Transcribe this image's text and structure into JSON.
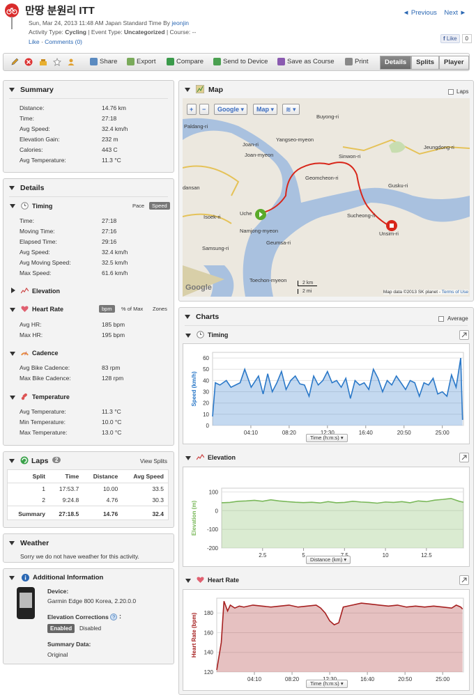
{
  "header": {
    "title": "만땅 분원리 ITT",
    "date_line": "Sun, Mar 24, 2013 11:48 AM Japan Standard Time By ",
    "author": "jeonjin",
    "activity_type_label": "Activity Type: ",
    "activity_type": "Cycling",
    "event_type_label": " | Event Type: ",
    "event_type": "Uncategorized",
    "course_label": " | Course: --",
    "like_link": "Like",
    "comments_link": "Comments (0)",
    "previous": "◄ Previous",
    "next": "Next ►",
    "fb_like": "Like",
    "fb_count": "0"
  },
  "toolbar": {
    "share": "Share",
    "export": "Export",
    "compare": "Compare",
    "send": "Send to Device",
    "save_course": "Save as Course",
    "print": "Print",
    "tabs": [
      "Details",
      "Splits",
      "Player"
    ]
  },
  "summary": {
    "title": "Summary",
    "rows": [
      {
        "label": "Distance:",
        "value": "14.76 km"
      },
      {
        "label": "Time:",
        "value": "27:18"
      },
      {
        "label": "Avg Speed:",
        "value": "32.4 km/h"
      },
      {
        "label": "Elevation Gain:",
        "value": "232 m"
      },
      {
        "label": "Calories:",
        "value": "443 C"
      },
      {
        "label": "Avg Temperature:",
        "value": "11.3 °C"
      }
    ]
  },
  "details": {
    "title": "Details",
    "timing": {
      "title": "Timing",
      "pace": "Pace",
      "speed": "Speed",
      "rows": [
        {
          "label": "Time:",
          "value": "27:18"
        },
        {
          "label": "Moving Time:",
          "value": "27:16"
        },
        {
          "label": "Elapsed Time:",
          "value": "29:16"
        },
        {
          "label": "Avg Speed:",
          "value": "32.4 km/h"
        },
        {
          "label": "Avg Moving Speed:",
          "value": "32.5 km/h"
        },
        {
          "label": "Max Speed:",
          "value": "61.6 km/h"
        }
      ]
    },
    "elevation": {
      "title": "Elevation"
    },
    "heart_rate": {
      "title": "Heart Rate",
      "bpm": "bpm",
      "pct_max": "% of Max",
      "zones": "Zones",
      "rows": [
        {
          "label": "Avg HR:",
          "value": "185 bpm"
        },
        {
          "label": "Max HR:",
          "value": "195 bpm"
        }
      ]
    },
    "cadence": {
      "title": "Cadence",
      "rows": [
        {
          "label": "Avg Bike Cadence:",
          "value": "83 rpm"
        },
        {
          "label": "Max Bike Cadence:",
          "value": "128 rpm"
        }
      ]
    },
    "temperature": {
      "title": "Temperature",
      "rows": [
        {
          "label": "Avg Temperature:",
          "value": "11.3 °C"
        },
        {
          "label": "Min Temperature:",
          "value": "10.0 °C"
        },
        {
          "label": "Max Temperature:",
          "value": "13.0 °C"
        }
      ]
    }
  },
  "laps": {
    "title": "Laps",
    "count": "2",
    "view_splits": "View Splits",
    "columns": [
      "Split",
      "Time",
      "Distance",
      "Avg Speed"
    ],
    "rows": [
      [
        "1",
        "17:53.7",
        "10.00",
        "33.5"
      ],
      [
        "2",
        "9:24.8",
        "4.76",
        "30.3"
      ]
    ],
    "summary": [
      "Summary",
      "27:18.5",
      "14.76",
      "32.4"
    ]
  },
  "weather": {
    "title": "Weather",
    "text": "Sorry we do not have weather for this activity."
  },
  "additional": {
    "title": "Additional Information",
    "device_label": "Device:",
    "device": "Garmin Edge 800 Korea, 2.20.0.0",
    "elev_corr_label": "Elevation Corrections",
    "enabled": "Enabled",
    "disabled": "Disabled",
    "summary_data_label": "Summary Data:",
    "summary_data": "Original"
  },
  "map": {
    "title": "Map",
    "laps_label": "Laps",
    "zoom_in": "+",
    "zoom_out": "−",
    "google_btn": "Google ▾",
    "map_btn": "Map ▾",
    "places": [
      "Paldang-ri",
      "Buyong-ri",
      "Joan-ri",
      "Yangseo-myeon",
      "Joan-myeon",
      "Sinwon-ri",
      "Jeungdong-ri",
      "Geomcheon-ri",
      "Gusku-ri",
      "Isoek-ri",
      "Namjong-myeon",
      "Sucheong-ri",
      "Samsung-ri",
      "Geumsa-ri",
      "Unsim-ri",
      "Toechon-myeon",
      "dansan",
      "Uche"
    ],
    "scale_km": "2 km",
    "scale_mi": "2 mi",
    "attribution": "Map data ©2013 SK planet -",
    "terms": "Terms of Use",
    "google": "Google"
  },
  "charts": {
    "title": "Charts",
    "average": "Average",
    "timing": {
      "title": "Timing",
      "selector": "Time (h:m:s) ▾"
    },
    "elevation": {
      "title": "Elevation",
      "selector": "Distance (km) ▾"
    },
    "heart_rate": {
      "title": "Heart Rate",
      "selector": "Time (h:m:s) ▾"
    }
  },
  "chart_data": [
    {
      "type": "area",
      "title": "Timing",
      "ylabel": "Speed (km/h)",
      "xlabel": "Time (h:m:s)",
      "ylim": [
        0,
        65
      ],
      "yticks": [
        0,
        10,
        20,
        30,
        40,
        50,
        60
      ],
      "xticks": [
        "04:10",
        "08:20",
        "12:30",
        "16:40",
        "20:50",
        "25:00"
      ],
      "color": "#2a78c8",
      "x_minutes": [
        0,
        0.3,
        0.8,
        1.5,
        2,
        3,
        3.5,
        4.2,
        5,
        5.5,
        6,
        6.5,
        7,
        7.5,
        8,
        8.5,
        9,
        9.5,
        10,
        10.5,
        11,
        11.5,
        12,
        12.5,
        13,
        13.5,
        14,
        14.5,
        15,
        15.5,
        16,
        16.5,
        17,
        17.5,
        18,
        18.5,
        19,
        19.5,
        20,
        20.5,
        21,
        21.5,
        22,
        22.5,
        23,
        23.5,
        24,
        24.5,
        25,
        25.5,
        26,
        26.5,
        27,
        27.2
      ],
      "values": [
        8,
        38,
        36,
        40,
        34,
        38,
        50,
        34,
        44,
        28,
        46,
        30,
        38,
        48,
        32,
        40,
        44,
        37,
        36,
        26,
        44,
        36,
        40,
        48,
        38,
        40,
        34,
        42,
        24,
        40,
        36,
        38,
        32,
        50,
        42,
        30,
        40,
        36,
        44,
        38,
        32,
        40,
        38,
        26,
        38,
        36,
        42,
        28,
        30,
        26,
        45,
        34,
        60,
        5
      ]
    },
    {
      "type": "area",
      "title": "Elevation",
      "ylabel": "Elevation (m)",
      "xlabel": "Distance (km)",
      "ylim": [
        -200,
        120
      ],
      "yticks": [
        -200,
        -100,
        0,
        100
      ],
      "xticks": [
        2.5,
        5,
        7.5,
        10,
        12.5
      ],
      "color": "#7ab85a",
      "x_km": [
        0,
        0.5,
        1,
        1.5,
        2,
        2.5,
        3,
        3.5,
        4,
        4.5,
        5,
        5.5,
        6,
        6.5,
        7,
        7.5,
        8,
        8.5,
        9,
        9.5,
        10,
        10.5,
        11,
        11.5,
        12,
        12.5,
        13,
        13.5,
        14,
        14.5,
        14.76
      ],
      "values": [
        42,
        44,
        50,
        52,
        55,
        50,
        58,
        52,
        48,
        45,
        43,
        45,
        41,
        48,
        42,
        44,
        50,
        46,
        44,
        40,
        46,
        44,
        48,
        42,
        52,
        48,
        56,
        60,
        65,
        50,
        45
      ]
    },
    {
      "type": "area",
      "title": "Heart Rate",
      "ylabel": "Heart Rate (bpm)",
      "xlabel": "Time (h:m:s)",
      "ylim": [
        120,
        195
      ],
      "yticks": [
        120,
        140,
        160,
        180
      ],
      "xticks": [
        "04:10",
        "08:20",
        "12:30",
        "16:40",
        "20:50",
        "25:00"
      ],
      "color": "#a62020",
      "x_minutes": [
        0,
        0.5,
        0.8,
        1.2,
        1.5,
        2,
        2.5,
        3,
        4,
        5,
        6,
        7,
        8,
        9,
        10,
        11,
        11.5,
        12,
        12.5,
        13,
        13.5,
        14,
        15,
        16,
        17,
        18,
        19,
        20,
        21,
        22,
        23,
        24,
        25,
        26,
        26.5,
        27,
        27.2
      ],
      "values": [
        122,
        150,
        192,
        182,
        188,
        185,
        187,
        186,
        188,
        187,
        186,
        187,
        188,
        186,
        187,
        188,
        185,
        180,
        172,
        168,
        170,
        186,
        188,
        190,
        189,
        188,
        187,
        188,
        186,
        187,
        186,
        187,
        186,
        185,
        188,
        186,
        184
      ]
    }
  ]
}
